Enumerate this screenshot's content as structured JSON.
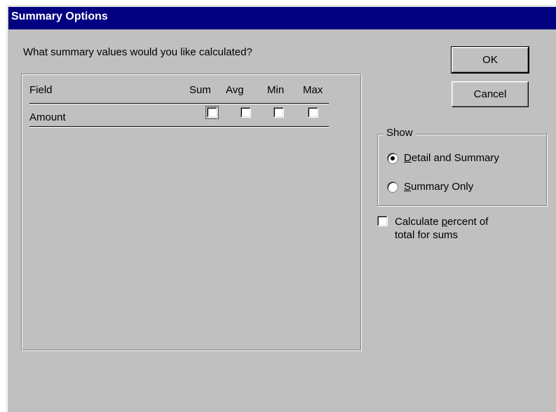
{
  "dialog": {
    "title": "Summary Options"
  },
  "prompt": "What summary values would you like calculated?",
  "table": {
    "columns": [
      "Field",
      "Sum",
      "Avg",
      "Min",
      "Max"
    ],
    "rows": [
      {
        "field": "Amount",
        "sum": false,
        "avg": false,
        "min": false,
        "max": false
      }
    ]
  },
  "buttons": {
    "ok": "OK",
    "cancel": "Cancel"
  },
  "show_group": {
    "label": "Show",
    "options": [
      {
        "mnemonic": "D",
        "rest": "etail and Summary",
        "selected": true
      },
      {
        "mnemonic": "S",
        "rest": "ummary Only",
        "selected": false
      }
    ]
  },
  "percent_option": {
    "pre": "Calculate ",
    "mnemonic": "p",
    "line1_rest": "ercent of",
    "line2": "total for sums",
    "checked": false
  }
}
